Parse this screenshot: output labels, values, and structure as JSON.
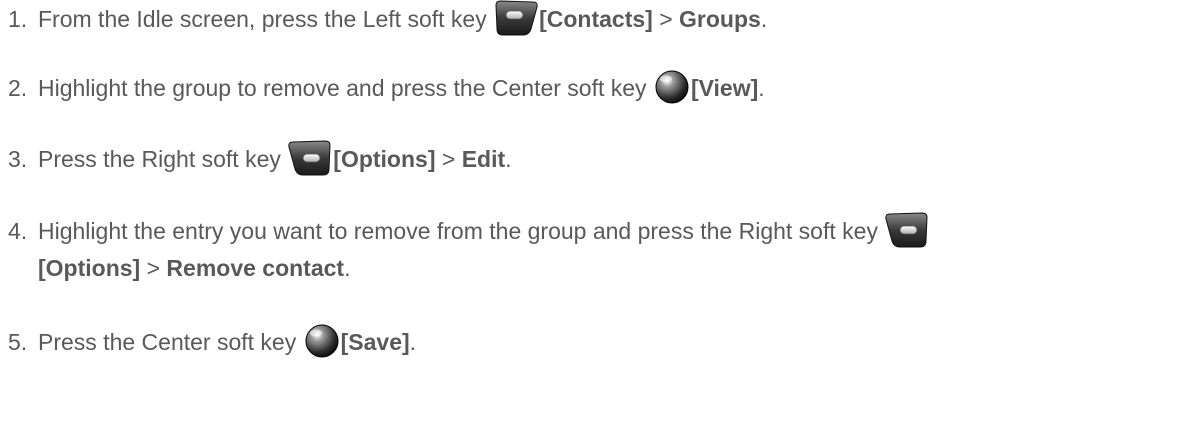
{
  "steps": [
    {
      "number": "1.",
      "text_before": "From the Idle screen, press the Left soft key ",
      "key_icon": "left-soft-key-icon",
      "bracket_label": "[Contacts]",
      "separator": " > ",
      "target": "Groups",
      "end": "."
    },
    {
      "number": "2.",
      "text_before": "Highlight the group to remove and press the Center soft key ",
      "key_icon": "center-soft-key-icon",
      "bracket_label": "[View]",
      "end": "."
    },
    {
      "number": "3.",
      "text_before": "Press the Right soft key ",
      "key_icon": "right-soft-key-icon",
      "bracket_label": "[Options]",
      "separator": " > ",
      "target": "Edit",
      "end": "."
    },
    {
      "number": "4.",
      "text_before": "Highlight the entry you want to remove from the group and press the Right soft key ",
      "key_icon": "right-soft-key-icon",
      "bracket_label": "[Options]",
      "separator": " > ",
      "target": "Remove contact",
      "end": "."
    },
    {
      "number": "5.",
      "text_before": "Press the Center soft key ",
      "key_icon": "center-soft-key-icon",
      "bracket_label": "[Save]",
      "end": "."
    }
  ]
}
